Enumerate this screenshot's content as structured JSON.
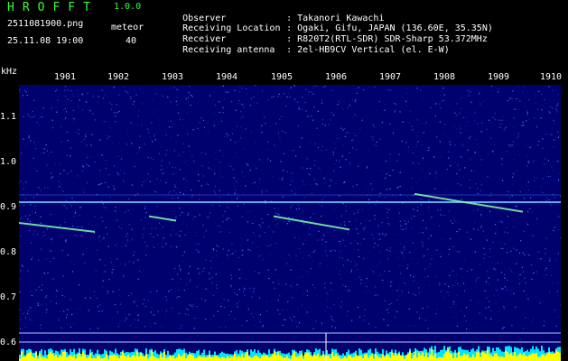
{
  "header": {
    "title": "HROFFT",
    "version": "1.0.0",
    "filename": "2511081900.png",
    "datetime": "25.11.08 19:00",
    "mode_label": "meteor",
    "count": "40",
    "info": [
      {
        "label": "Observer",
        "value": ": Takanori Kawachi"
      },
      {
        "label": "Receiving Location",
        "value": ": Ogaki, Gifu, JAPAN (136.60E, 35.35N)"
      },
      {
        "label": "Receiver",
        "value": ": R820T2(RTL-SDR) SDR-Sharp 53.372MHz"
      },
      {
        "label": "Receiving antenna",
        "value": ": 2el-HB9CV Vertical (el. E-W)"
      }
    ]
  },
  "axis": {
    "unit": "kHz",
    "x_ticks": [
      "1901",
      "1902",
      "1903",
      "1904",
      "1905",
      "1906",
      "1907",
      "1908",
      "1909",
      "1910"
    ],
    "y_ticks": [
      "1.1",
      "1.0",
      "0.9",
      "0.8",
      "0.7",
      "0.6"
    ]
  },
  "colors": {
    "background": "#00006e",
    "carrier": "#6ec8ff",
    "trail": "#7fffb0",
    "trail_hot": "#ff6060",
    "bar_cyan": "#00e5ff",
    "bar_yellow": "#ffff00",
    "marker_line": "#b0c8ff"
  },
  "chart_data": {
    "type": "spectrogram",
    "x_unit": "time (HHMM)",
    "y_unit": "kHz",
    "xlim": [
      "19:00",
      "19:10"
    ],
    "ylim": [
      0.58,
      1.2
    ],
    "carrier_khz": 0.9,
    "echoes": [
      {
        "t_start": "19:00.0",
        "t_end": "19:01.4",
        "khz_start": 0.89,
        "khz_end": 0.87
      },
      {
        "t_start": "19:02.4",
        "t_end": "19:02.9",
        "khz_start": 0.905,
        "khz_end": 0.895
      },
      {
        "t_start": "19:04.7",
        "t_end": "19:06.1",
        "khz_start": 0.905,
        "khz_end": 0.875
      },
      {
        "t_start": "19:07.3",
        "t_end": "19:09.3",
        "khz_start": 0.955,
        "khz_end": 0.915
      }
    ]
  }
}
